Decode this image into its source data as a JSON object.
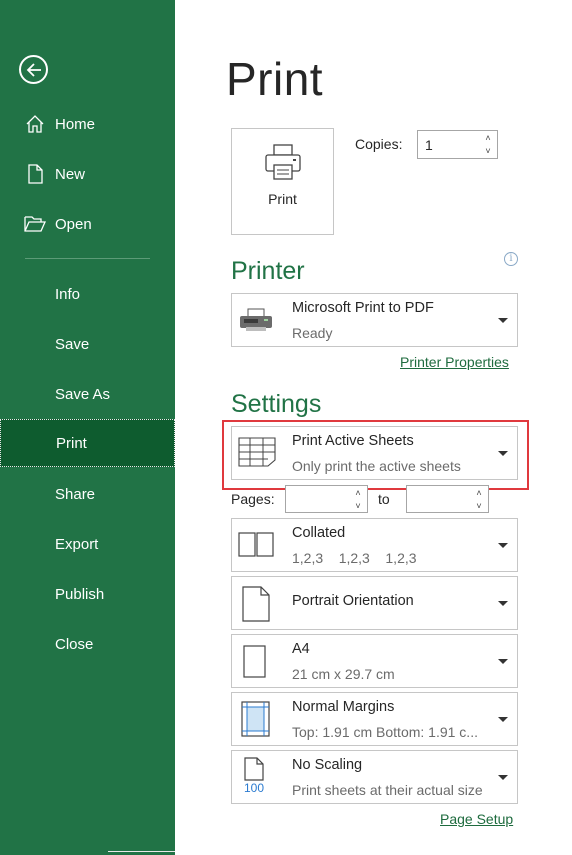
{
  "sidebar": {
    "items": [
      {
        "label": "Home",
        "icon": "home-icon"
      },
      {
        "label": "New",
        "icon": "new-document-icon"
      },
      {
        "label": "Open",
        "icon": "folder-open-icon"
      },
      {
        "label": "Info"
      },
      {
        "label": "Save"
      },
      {
        "label": "Save As"
      },
      {
        "label": "Print",
        "active": true
      },
      {
        "label": "Share"
      },
      {
        "label": "Export"
      },
      {
        "label": "Publish"
      },
      {
        "label": "Close"
      }
    ],
    "colors": {
      "background": "#217346",
      "active": "#0e5c2f"
    }
  },
  "main": {
    "title": "Print",
    "print_button_label": "Print",
    "copies": {
      "label": "Copies:",
      "value": "1"
    },
    "printer": {
      "heading": "Printer",
      "name": "Microsoft Print to PDF",
      "status": "Ready",
      "properties_link": "Printer Properties"
    },
    "settings": {
      "heading": "Settings",
      "what_to_print": {
        "main": "Print Active Sheets",
        "sub": "Only print the active sheets"
      },
      "pages": {
        "label": "Pages:",
        "from": "",
        "to_label": "to",
        "to": ""
      },
      "collation": {
        "main": "Collated",
        "sub": "1,2,3    1,2,3    1,2,3"
      },
      "orientation": {
        "main": "Portrait Orientation"
      },
      "paper": {
        "main": "A4",
        "sub": "21 cm x 29.7 cm"
      },
      "margins": {
        "main": "Normal Margins",
        "sub": "Top: 1.91 cm Bottom: 1.91 c..."
      },
      "scaling": {
        "main": "No Scaling",
        "sub": "Print sheets at their actual size",
        "icon_text": "100"
      },
      "page_setup_link": "Page Setup"
    },
    "colors": {
      "accent": "#217346",
      "highlight": "#e0393e",
      "link": "#1e6b3e"
    }
  }
}
